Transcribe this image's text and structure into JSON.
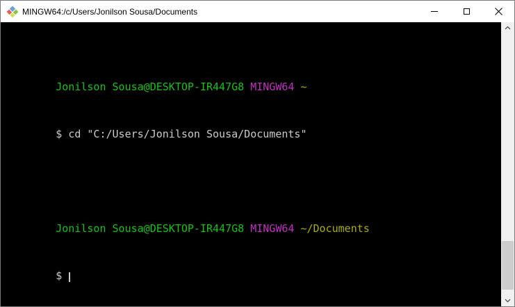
{
  "window": {
    "titlebar": {
      "title": "MINGW64:/c/Users/Jonilson Sousa/Documents",
      "icons": {
        "app": "git-bash-diamond-icon",
        "minimize": "minimize-line",
        "maximize": "maximize-square",
        "close": "close-x"
      }
    },
    "border_color": "#7a7a7a",
    "titlebar_background": "#ffffff"
  },
  "terminal": {
    "palette": {
      "background": "#000000",
      "foreground": "#cbcbcb",
      "green": "#15c415",
      "magenta": "#c32ec3",
      "yellow": "#adad00"
    },
    "lines": [
      {
        "type": "prompt",
        "segments": [
          {
            "text": "Jonilson Sousa@DESKTOP-IR447G8",
            "color": "green"
          },
          {
            "text": " MINGW64",
            "color": "magenta"
          },
          {
            "text": " ~",
            "color": "yellow"
          }
        ]
      },
      {
        "type": "command",
        "text": "$ cd \"C:/Users/Jonilson Sousa/Documents\""
      },
      {
        "type": "blank",
        "text": ""
      },
      {
        "type": "prompt",
        "segments": [
          {
            "text": "Jonilson Sousa@DESKTOP-IR447G8",
            "color": "green"
          },
          {
            "text": " MINGW64",
            "color": "magenta"
          },
          {
            "text": " ~/Documents",
            "color": "yellow"
          }
        ]
      },
      {
        "type": "input",
        "text": "$ ",
        "cursor": true
      }
    ]
  },
  "scrollbar": {
    "icons": {
      "up": "chevron-up",
      "down": "chevron-down"
    },
    "track_color": "#f0f0f0",
    "thumb_color": "#cdcdcd"
  }
}
